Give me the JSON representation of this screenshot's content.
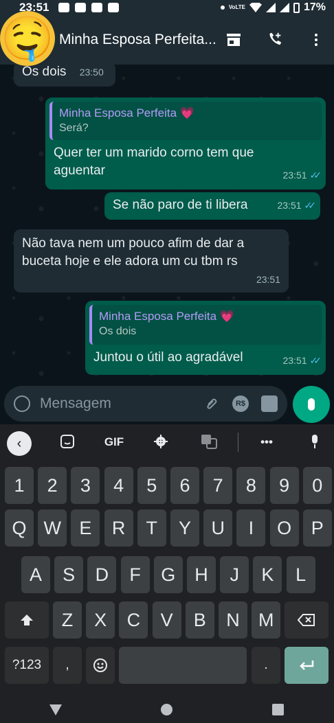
{
  "status_bar": {
    "time": "23:51",
    "network": "VoLTE",
    "battery": "17%"
  },
  "header": {
    "contact_name": "Minha Esposa Perfeita...",
    "avatar_emoji": "🤤"
  },
  "messages": [
    {
      "direction": "in",
      "text": "Os dois",
      "time": "23:50"
    },
    {
      "direction": "out",
      "quote_name": "Minha Esposa Perfeita 💗",
      "quote_text": "Será?",
      "text": "Quer ter um marido corno tem que aguentar",
      "time": "23:51",
      "status": "read"
    },
    {
      "direction": "out",
      "text": "Se não paro de ti libera",
      "time": "23:51",
      "status": "read"
    },
    {
      "direction": "in",
      "text": "Não tava nem um pouco afim de dar a buceta hoje e ele adora um cu tbm rs",
      "time": "23:51"
    },
    {
      "direction": "out",
      "quote_name": "Minha Esposa Perfeita 💗",
      "quote_text": "Os dois",
      "text": "Juntou o útil ao agradável",
      "time": "23:51",
      "status": "read"
    }
  ],
  "input": {
    "placeholder": "Mensagem",
    "currency_label": "R$"
  },
  "keyboard": {
    "toolbar": {
      "gif": "GIF",
      "more": "•••"
    },
    "numbers": [
      "1",
      "2",
      "3",
      "4",
      "5",
      "6",
      "7",
      "8",
      "9",
      "0"
    ],
    "row1": [
      "Q",
      "W",
      "E",
      "R",
      "T",
      "Y",
      "U",
      "I",
      "O",
      "P"
    ],
    "row2": [
      "A",
      "S",
      "D",
      "F",
      "G",
      "H",
      "J",
      "K",
      "L"
    ],
    "row3": [
      "Z",
      "X",
      "C",
      "V",
      "B",
      "N",
      "M"
    ],
    "symbols_key": "?123",
    "comma": ",",
    "period": "."
  },
  "colors": {
    "accent": "#00a884",
    "bubble_out": "#005c4b",
    "bubble_in": "#1f2c34",
    "read_ticks": "#53bdeb"
  }
}
